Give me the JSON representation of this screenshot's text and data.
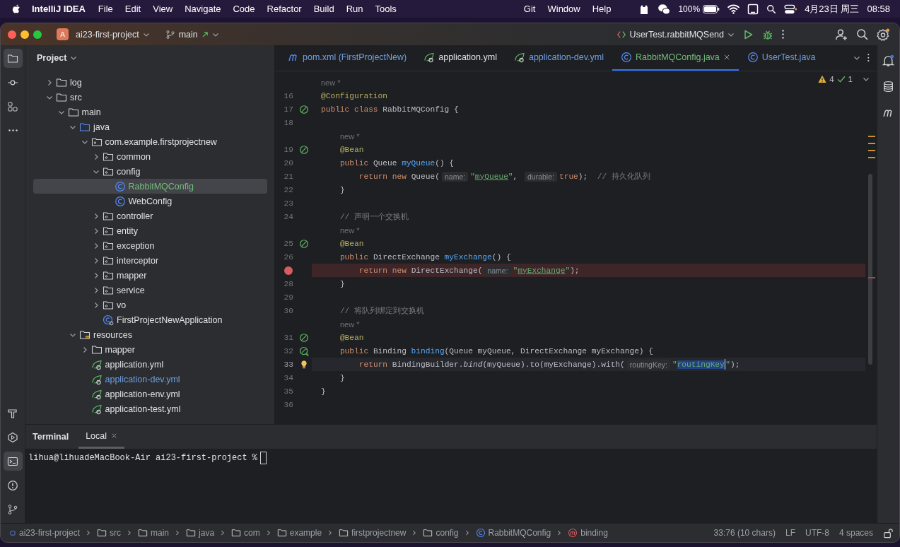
{
  "menu_bar": {
    "app": "IntelliJ IDEA",
    "menus": [
      "File",
      "Edit",
      "View",
      "Navigate",
      "Code",
      "Refactor",
      "Build",
      "Run",
      "Tools"
    ],
    "menus_after_notch": [
      "Git",
      "Window",
      "Help"
    ],
    "battery": "100%",
    "date": "4月23日 周三",
    "time": "08:58"
  },
  "title_bar": {
    "project_badge": "A",
    "project": "ai23-first-project",
    "branch": "main",
    "run_config": "UserTest.rabbitMQSend"
  },
  "tool_strip_top": [
    {
      "kind": "project",
      "selected": true
    },
    {
      "kind": "commit",
      "selected": false
    },
    {
      "kind": "structure",
      "selected": false
    },
    {
      "kind": "more",
      "selected": false
    }
  ],
  "tool_strip_bottom": [
    {
      "kind": "build",
      "selected": false
    },
    {
      "kind": "run",
      "selected": false
    },
    {
      "kind": "terminal",
      "selected": true
    },
    {
      "kind": "problems",
      "selected": false
    },
    {
      "kind": "git",
      "selected": false
    }
  ],
  "project_panel": {
    "title": "Project",
    "tree": [
      {
        "label": "log",
        "kind": "folder",
        "expanded": false,
        "selected": false
      },
      {
        "label": "src",
        "kind": "folder",
        "expanded": true,
        "selected": false,
        "children": [
          {
            "label": "main",
            "kind": "folder",
            "expanded": true,
            "selected": false,
            "children": [
              {
                "label": "java",
                "kind": "source",
                "expanded": true,
                "selected": false,
                "children": [
                  {
                    "label": "com.example.firstprojectnew",
                    "kind": "package",
                    "expanded": true,
                    "selected": false,
                    "children": [
                      {
                        "label": "common",
                        "kind": "package",
                        "expanded": false,
                        "selected": false
                      },
                      {
                        "label": "config",
                        "kind": "package",
                        "expanded": true,
                        "selected": false,
                        "children": [
                          {
                            "label": "RabbitMQConfig",
                            "kind": "class",
                            "selected": true,
                            "color": "#73bd79"
                          },
                          {
                            "label": "WebConfig",
                            "kind": "class",
                            "selected": false
                          }
                        ]
                      },
                      {
                        "label": "controller",
                        "kind": "package",
                        "expanded": false,
                        "selected": false
                      },
                      {
                        "label": "entity",
                        "kind": "package",
                        "expanded": false,
                        "selected": false
                      },
                      {
                        "label": "exception",
                        "kind": "package",
                        "expanded": false,
                        "selected": false
                      },
                      {
                        "label": "interceptor",
                        "kind": "package",
                        "expanded": false,
                        "selected": false
                      },
                      {
                        "label": "mapper",
                        "kind": "package",
                        "expanded": false,
                        "selected": false
                      },
                      {
                        "label": "service",
                        "kind": "package",
                        "expanded": false,
                        "selected": false
                      },
                      {
                        "label": "vo",
                        "kind": "package",
                        "expanded": false,
                        "selected": false
                      },
                      {
                        "label": "FirstProjectNewApplication",
                        "kind": "app",
                        "selected": false
                      }
                    ]
                  }
                ]
              },
              {
                "label": "resources",
                "kind": "resources",
                "expanded": true,
                "selected": false,
                "children": [
                  {
                    "label": "mapper",
                    "kind": "folder",
                    "expanded": false,
                    "selected": false
                  },
                  {
                    "label": "application.yml",
                    "kind": "yml",
                    "selected": false
                  },
                  {
                    "label": "application-dev.yml",
                    "kind": "yml",
                    "selected": false,
                    "color": "#6f9fe0"
                  },
                  {
                    "label": "application-env.yml",
                    "kind": "yml",
                    "selected": false
                  },
                  {
                    "label": "application-test.yml",
                    "kind": "yml",
                    "selected": false
                  }
                ]
              }
            ]
          }
        ]
      }
    ]
  },
  "editor": {
    "tabs": [
      {
        "label": "pom.xml (FirstProjectNew)",
        "kind": "maven",
        "selected": false,
        "color": "#6f9fe0"
      },
      {
        "label": "application.yml",
        "kind": "yml",
        "selected": false
      },
      {
        "label": "application-dev.yml",
        "kind": "yml",
        "selected": false,
        "color": "#6f9fe0"
      },
      {
        "label": "RabbitMQConfig.java",
        "kind": "class",
        "selected": true,
        "color": "#73bd79"
      },
      {
        "label": "UserTest.java",
        "kind": "class",
        "selected": false,
        "color": "#6f9fe0"
      }
    ],
    "warnings": "4",
    "passed": "1",
    "lines": [
      {
        "kind": "author",
        "text": "new *"
      },
      {
        "kind": "code",
        "num": "16",
        "current": false,
        "tokens": [
          {
            "text": "@Configuration",
            "kind": "ann"
          }
        ]
      },
      {
        "kind": "code",
        "num": "17",
        "gutter": {
          "kind": "bean"
        },
        "current": false,
        "tokens": [
          {
            "text": "public class ",
            "kind": "kw"
          },
          {
            "text": "RabbitMQConfig {",
            "kind": "p"
          }
        ],
        "children": [
          {
            "kind": "code",
            "num": "18",
            "current": false
          },
          {
            "kind": "author",
            "text": "new *"
          },
          {
            "kind": "code",
            "num": "19",
            "gutter": {
              "kind": "bean"
            },
            "current": false,
            "tokens": [
              {
                "text": "@Bean",
                "kind": "ann"
              }
            ]
          },
          {
            "kind": "code",
            "num": "20",
            "current": false,
            "tokens": [
              {
                "text": "public ",
                "kind": "kw"
              },
              {
                "text": "Queue ",
                "kind": "p"
              },
              {
                "text": "myQueue",
                "kind": "fn"
              },
              {
                "text": "() {",
                "kind": "p"
              }
            ],
            "children": [
              {
                "kind": "code",
                "num": "21",
                "current": false,
                "tokens": [
                  {
                    "text": "return new ",
                    "kind": "kw"
                  },
                  {
                    "text": "Queue(",
                    "kind": "p"
                  },
                  {
                    "text": "name:",
                    "kind": "hint"
                  },
                  {
                    "text": "\"",
                    "kind": "str"
                  },
                  {
                    "text": "myQueue",
                    "kind": "ref"
                  },
                  {
                    "text": "\"",
                    "kind": "str"
                  },
                  {
                    "text": ", ",
                    "kind": "p"
                  },
                  {
                    "text": "durable:",
                    "kind": "hint"
                  },
                  {
                    "text": "true",
                    "kind": "kw"
                  },
                  {
                    "text": ");  ",
                    "kind": "p"
                  },
                  {
                    "text": "// 持久化队列",
                    "kind": "cm"
                  }
                ]
              }
            ]
          },
          {
            "kind": "code",
            "num": "22",
            "current": false,
            "tokens": [
              {
                "text": "}",
                "kind": "p"
              }
            ]
          },
          {
            "kind": "code",
            "num": "23",
            "current": false
          },
          {
            "kind": "code",
            "num": "24",
            "current": false,
            "tokens": [
              {
                "text": "// 声明一个交换机",
                "kind": "cm"
              }
            ]
          },
          {
            "kind": "author",
            "text": "new *"
          },
          {
            "kind": "code",
            "num": "25",
            "gutter": {
              "kind": "bean"
            },
            "current": false,
            "tokens": [
              {
                "text": "@Bean",
                "kind": "ann"
              }
            ]
          },
          {
            "kind": "code",
            "num": "26",
            "current": false,
            "tokens": [
              {
                "text": "public ",
                "kind": "kw"
              },
              {
                "text": "DirectExchange ",
                "kind": "p"
              },
              {
                "text": "myExchange",
                "kind": "fn"
              },
              {
                "text": "() {",
                "kind": "p"
              }
            ],
            "children": [
              {
                "kind": "code",
                "gutter": {
                  "kind": "breakpoint"
                },
                "current": false,
                "tokens": [
                  {
                    "text": "return new ",
                    "kind": "kw"
                  },
                  {
                    "text": "DirectExchange(",
                    "kind": "p"
                  },
                  {
                    "text": "name:",
                    "kind": "hint"
                  },
                  {
                    "text": "\"",
                    "kind": "str"
                  },
                  {
                    "text": "myExchange",
                    "kind": "ref"
                  },
                  {
                    "text": "\"",
                    "kind": "str"
                  },
                  {
                    "text": ");",
                    "kind": "p"
                  }
                ]
              }
            ]
          },
          {
            "kind": "code",
            "num": "28",
            "current": false,
            "tokens": [
              {
                "text": "}",
                "kind": "p"
              }
            ]
          },
          {
            "kind": "code",
            "num": "29",
            "current": false
          },
          {
            "kind": "code",
            "num": "30",
            "current": false,
            "tokens": [
              {
                "text": "// 将队列绑定到交换机",
                "kind": "cm"
              }
            ]
          },
          {
            "kind": "author",
            "text": "new *"
          },
          {
            "kind": "code",
            "num": "31",
            "gutter": {
              "kind": "bean"
            },
            "current": false,
            "tokens": [
              {
                "text": "@Bean",
                "kind": "ann"
              }
            ]
          },
          {
            "kind": "code",
            "num": "32",
            "gutter": {
              "kind": "bean-nav"
            },
            "current": false,
            "tokens": [
              {
                "text": "public ",
                "kind": "kw"
              },
              {
                "text": "Binding ",
                "kind": "p"
              },
              {
                "text": "binding",
                "kind": "fn"
              },
              {
                "text": "(Queue myQueue, DirectExchange myExchange) {",
                "kind": "p"
              }
            ],
            "children": [
              {
                "kind": "code",
                "num": "33",
                "gutter": {
                  "kind": "bulb"
                },
                "current": true,
                "tokens": [
                  {
                    "text": "return ",
                    "kind": "kw"
                  },
                  {
                    "text": "BindingBuilder.",
                    "kind": "p"
                  },
                  {
                    "text": "bind",
                    "kind": "it"
                  },
                  {
                    "text": "(myQueue).to(myExchange).with(",
                    "kind": "p"
                  },
                  {
                    "text": "routingKey:",
                    "kind": "hint"
                  },
                  {
                    "text": "\"",
                    "kind": "str"
                  },
                  {
                    "text": "routingKey",
                    "kind": "sel"
                  },
                  {
                    "text": "\"",
                    "kind": "str"
                  },
                  {
                    "text": ");",
                    "kind": "p"
                  }
                ]
              }
            ]
          },
          {
            "kind": "code",
            "num": "34",
            "current": false,
            "tokens": [
              {
                "text": "}",
                "kind": "p"
              }
            ]
          }
        ]
      },
      {
        "kind": "code",
        "num": "35",
        "current": false,
        "tokens": [
          {
            "text": "}",
            "kind": "p"
          }
        ]
      },
      {
        "kind": "code",
        "num": "36",
        "current": false
      }
    ]
  },
  "terminal": {
    "title": "Terminal",
    "tabs": [
      {
        "label": "Local",
        "selected": true
      }
    ],
    "prompt": "lihua@lihuadeMacBook-Air ai23-first-project %"
  },
  "status_bar": {
    "breadcrumbs": [
      {
        "label": "ai23-first-project",
        "kind": "module"
      },
      {
        "label": "src",
        "kind": "folder"
      },
      {
        "label": "main",
        "kind": "folder"
      },
      {
        "label": "java",
        "kind": "folder"
      },
      {
        "label": "com",
        "kind": "folder"
      },
      {
        "label": "example",
        "kind": "folder"
      },
      {
        "label": "firstprojectnew",
        "kind": "folder"
      },
      {
        "label": "config",
        "kind": "folder"
      },
      {
        "label": "RabbitMQConfig",
        "kind": "class"
      },
      {
        "label": "binding",
        "kind": "method"
      }
    ],
    "position": "33:76 (10 chars)",
    "line_ending": "LF",
    "encoding": "UTF-8",
    "indent": "4 spaces"
  }
}
